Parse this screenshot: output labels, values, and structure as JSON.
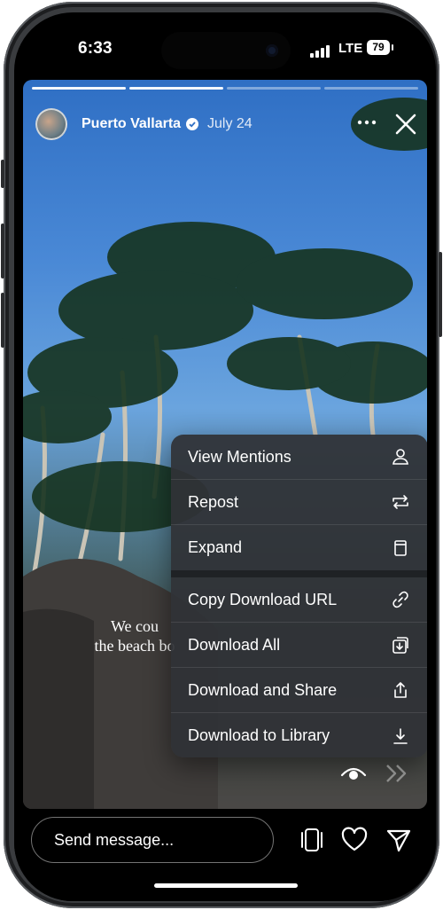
{
  "status_bar": {
    "time": "6:33",
    "network": "LTE",
    "battery": "79"
  },
  "story": {
    "account_name": "Puerto Vallarta",
    "date": "July 24",
    "progress_segments": 4,
    "progress_completed": 2,
    "caption_line1": "We cou",
    "caption_line2": "the beach bo"
  },
  "menu": {
    "items": [
      {
        "label": "View Mentions",
        "icon": "person-icon"
      },
      {
        "label": "Repost",
        "icon": "repost-icon"
      },
      {
        "label": "Expand",
        "icon": "expand-icon"
      },
      {
        "label": "Copy Download URL",
        "icon": "link-icon"
      },
      {
        "label": "Download All",
        "icon": "download-all-icon"
      },
      {
        "label": "Download and Share",
        "icon": "share-icon"
      },
      {
        "label": "Download to Library",
        "icon": "download-icon"
      }
    ]
  },
  "bottom_bar": {
    "message_placeholder": "Send message..."
  },
  "colors": {
    "menu_bg": "#303236",
    "accent": "#ffffff",
    "sky": "#3f80d2"
  }
}
